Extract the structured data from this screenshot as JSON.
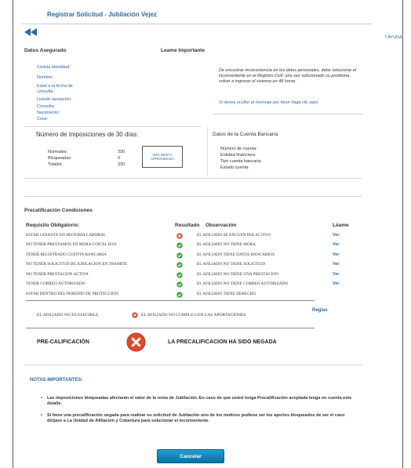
{
  "header": {
    "title": "Registrar Solicitud - Jubilación Vejez",
    "help": "? AYUDA"
  },
  "insured": {
    "title": "Datos Asegurado",
    "read_important": "Leame Importante",
    "labels": [
      "Cédula identidad:",
      "Nombre:",
      "Edad a la fecha de consulta:",
      "Listado apotación:",
      "Consulta:",
      "Nacimiento:",
      "Cese:"
    ],
    "notice": "De encontrar inconsistencia en los datos personales, debe solucionar el inconveniente en el Registro Civil; una vez solucionado su problema, volver a ingresar al sistema en 48 horas.",
    "notice_link": "Si desea ocultar el mensaje por favor haga clic aquí."
  },
  "imposiciones": {
    "title": "Número de Imposiciones de 30 días:",
    "rows": [
      {
        "label": "Normales:",
        "value": "330"
      },
      {
        "label": "Bloqueadas:",
        "value": "0"
      },
      {
        "label": "Totales:",
        "value": "330"
      }
    ],
    "button": "VER RENTA APROXIMADA"
  },
  "bank": {
    "title": "Datos de la Cuenta Bancaria",
    "labels": [
      "Número de cuenta:",
      "Entidad financiera:",
      "Tipo cuenta bancaria:",
      "Estado cuenta:"
    ]
  },
  "precalif": {
    "title": "Precalificación Condiciones",
    "headers": {
      "requisito": "Requisito Obligatorio:",
      "resultado": "Resultado",
      "observacion": "Observación",
      "leame": "Léame"
    },
    "rows": [
      {
        "req": "ESTAR CESANTE EN HISTORIA LABORAL",
        "status": "fail",
        "obs": "EL AFILIADO SE ENCUENTRA ACTIVO",
        "ver": "Ver"
      },
      {
        "req": "NO TENER PRESTAMOS EN MORA CON EL IESS",
        "status": "ok",
        "obs": "EL AFILIADO NO TIENE MORA",
        "ver": "Ver"
      },
      {
        "req": "TENER REGISTRADO CUENTA BANCARIA",
        "status": "ok",
        "obs": "EL AFILIADO TIENE DATOS BANCARIOS",
        "ver": "Ver"
      },
      {
        "req": "NO TENER SOLICITUD DE JUBILACION EN TRAMITE",
        "status": "ok",
        "obs": "EL AFILIADO NO TIENE SOLICITUD",
        "ver": "Ver"
      },
      {
        "req": "NO TENER PRESTACION ACTIVA",
        "status": "ok",
        "obs": "EL AFILIADO NO TIENE UNA PRESTACION",
        "ver": "Ver"
      },
      {
        "req": "TENER CORREO AUTORIZADO",
        "status": "ok",
        "obs": "EL AFILIADO NO TIENE CORREO AUTORIZADO",
        "ver": "Ver"
      },
      {
        "req": "ESTAR DENTRO DEL PERIODO DE PROTECCION",
        "status": "ok",
        "obs": "EL AFILIADO TIENE DERECHO",
        "ver": ""
      }
    ],
    "eligible_text": "EL AFILIADO NO ES ELEGIBLE",
    "eligible_obs": "EL AFILIADO NO CUMPLE CON LAS APORTACIONES",
    "reglas": "Reglas",
    "label": "PRE-CALIFICACIÓN",
    "result": "LA PRECALIFICACION HA SIDO NEGADA"
  },
  "notes": {
    "title": "NOTAS IMPORTANTES:",
    "items": [
      "Las imposiciones bloqueadas afectarán el valor de la renta de Jubilación. En caso de que usted tenga Precalificación aceptada tenga en cuenta este detalle.",
      "Si tiene una precalificación negada para realizar su solicitud de Jubilación uno de los motivos pudiese ser los aportes bloqueados de ser el caso diríjase a La Unidad de Afiliación y Cobertura para solucionar el inconveniente."
    ]
  },
  "footer": {
    "cancel": "Cancelar"
  },
  "colors": {
    "link": "#2a6aa8",
    "ok": "#3aa63a",
    "fail": "#e04a2a",
    "button": "#1589bb"
  }
}
